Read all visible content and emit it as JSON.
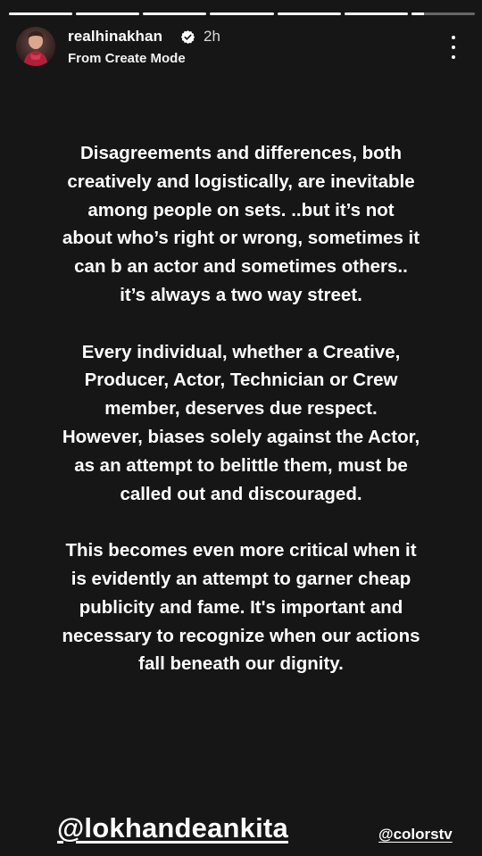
{
  "story": {
    "segments": [
      {
        "progress": 1.0
      },
      {
        "progress": 1.0
      },
      {
        "progress": 1.0
      },
      {
        "progress": 1.0
      },
      {
        "progress": 1.0
      },
      {
        "progress": 1.0
      },
      {
        "progress": 0.2
      }
    ],
    "accent_color": "#ffffff",
    "background_color": "#161616"
  },
  "header": {
    "username": "realhinakhan",
    "verified_icon": "verified-badge-icon",
    "time": "2h",
    "subtitle": "From Create Mode",
    "more_icon": "more-vertical-icon"
  },
  "statement": {
    "paragraphs": [
      "Disagreements and differences, both\ncreatively and logistically, are inevitable\namong people on sets. ..but it’s not\nabout who’s right or wrong, sometimes it\ncan b an actor and sometimes others..\nit’s always a two way street.",
      "Every individual, whether a Creative,\nProducer, Actor, Technician or Crew\nmember, deserves due respect.\nHowever, biases solely against the Actor,\nas an attempt to belittle them, must be\ncalled out and discouraged.",
      "This becomes even more critical when it\nis evidently an attempt to garner cheap\npublicity and fame. It's important and\nnecessary to recognize when our actions\nfall beneath our dignity."
    ]
  },
  "mentions": {
    "primary": "@lokhandeankita",
    "secondary": "@colorstv"
  }
}
